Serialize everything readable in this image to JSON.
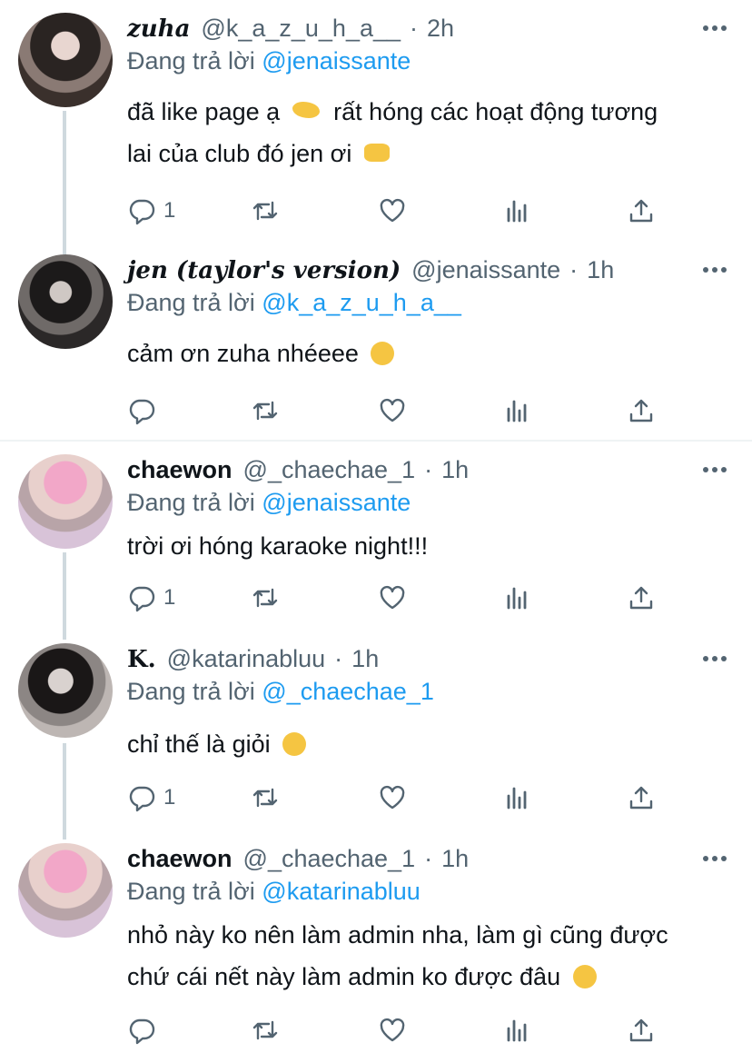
{
  "tweets": [
    {
      "name": "zuha",
      "handle": "@k_a_z_u_h_a__",
      "sep": "·",
      "time": "2h",
      "replying_label": "Đang trả lời",
      "replying_to": "@jenaissante",
      "line1": "đã like page ạ",
      "line1b": "rất hóng các hoạt động tương",
      "line2": "lai của club đó jen ơi",
      "reply_count": "1"
    },
    {
      "name": "jen (taylor's version)",
      "handle": "@jenaissante",
      "sep": "·",
      "time": "1h",
      "replying_label": "Đang trả lời",
      "replying_to": "@k_a_z_u_h_a__",
      "line1": "cảm ơn zuha nhéeee",
      "reply_count": ""
    },
    {
      "name": "chaewon",
      "handle": "@_chaechae_1",
      "sep": "·",
      "time": "1h",
      "replying_label": "Đang trả lời",
      "replying_to": "@jenaissante",
      "line1": "trời ơi hóng karaoke night!!!",
      "reply_count": "1"
    },
    {
      "name": "K.",
      "handle": "@katarinabluu",
      "sep": "·",
      "time": "1h",
      "replying_label": "Đang trả lời",
      "replying_to": "@_chaechae_1",
      "line1": "chỉ thế là giỏi",
      "reply_count": "1"
    },
    {
      "name": "chaewon",
      "handle": "@_chaechae_1",
      "sep": "·",
      "time": "1h",
      "replying_label": "Đang trả lời",
      "replying_to": "@katarinabluu",
      "line1": "nhỏ này ko nên làm admin nha, làm gì cũng được",
      "line2": "chứ cái nết này làm admin ko được đâu",
      "reply_count": ""
    }
  ],
  "icons": {
    "reply": "reply-icon",
    "retweet": "retweet-icon",
    "like": "like-icon",
    "views": "views-icon",
    "share": "share-icon",
    "more": "more-icon"
  },
  "colors": {
    "link": "#1d9bf0",
    "secondary": "#536471",
    "text": "#0f1419",
    "thread_line": "#cfd9de"
  }
}
